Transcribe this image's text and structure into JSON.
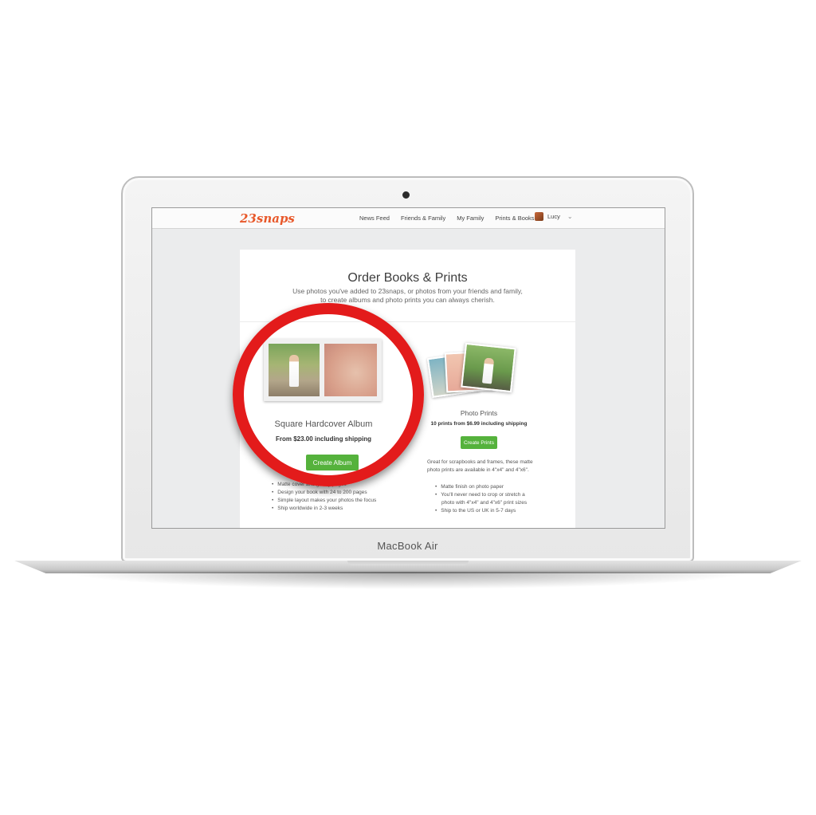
{
  "device": {
    "brand_label": "MacBook Air"
  },
  "app": {
    "logo": "23snaps",
    "nav": [
      "News Feed",
      "Friends & Family",
      "My Family",
      "Prints & Books"
    ],
    "user_name": "Lucy"
  },
  "page": {
    "title": "Order Books & Prints",
    "subtitle_line1": "Use photos you've added to 23snaps, or photos from your friends and family,",
    "subtitle_line2": "to create albums and photo prints you can always cherish."
  },
  "album": {
    "title": "Square Hardcover Album",
    "price": "From $23.00 including shipping",
    "button": "Create Album",
    "features": [
      "Matte cover and glossy pages",
      "Design your book with 24 to 200 pages",
      "Simple layout makes your photos the focus",
      "Ship worldwide in 2-3 weeks"
    ]
  },
  "prints": {
    "title": "Photo Prints",
    "price": "10 prints from $6.99 including shipping",
    "button": "Create Prints",
    "description": "Great for scrapbooks and frames, these matte photo prints are available in 4\"x4\" and 4\"x6\".",
    "features": [
      "Matte finish on photo paper",
      "You'll never need to crop or stretch a photo with 4\"x4\" and 4\"x6\" print sizes",
      "Ship to the US or UK in 5-7 days"
    ]
  },
  "colors": {
    "accent_green": "#55b23c",
    "logo_orange": "#e8582a",
    "highlight_red": "#e31b1b"
  }
}
